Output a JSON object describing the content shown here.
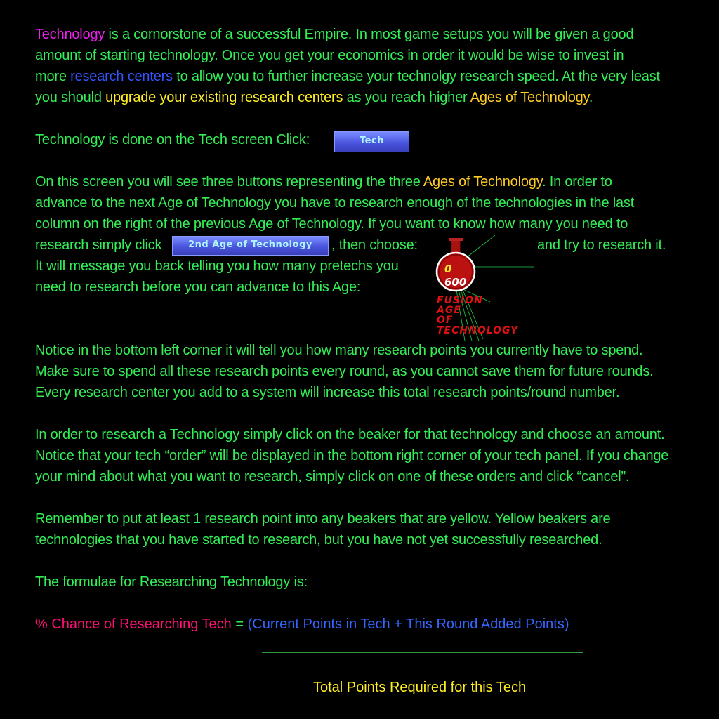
{
  "para1": {
    "tech_word": "Technology",
    "s1": " is a cornorstone of a successful Empire.  In most game setups you will be given a good",
    "l2": "amount of starting technology.  Once you get your economics in order it would be wise to invest in",
    "l3_pre": "more ",
    "research_centers": "research centers",
    "l3_post": " to allow you to further increase your technolgy research speed.  At the very least",
    "l4_pre": "you should ",
    "upgrade": "upgrade your existing research centers",
    "l4_mid": " as you reach higher ",
    "ages": "Ages of Technology",
    "l4_post": "."
  },
  "para2": {
    "text": "Technology is done on the Tech screen Click:",
    "tech_button": "Tech"
  },
  "para3": {
    "l1_pre": "On this screen you will see three buttons representing the three ",
    "ages": "Ages of Technology",
    "l1_post": ".  In order to",
    "l2": "advance to the next Age of Technology you have to research enough of the technologies in the last",
    "l3": "column on the right of the previous Age of Technology.  If you want to know how many you need to",
    "l4_pre": "research simply click",
    "age_button": "2nd Age of Technology",
    "l4_mid": ", then choose:",
    "l4_post": "and try to research it.",
    "l5": "It will message you back telling you how many pretechs you",
    "l6": " need to research before you can advance to this Age:"
  },
  "beaker": {
    "current": "0",
    "required": "600",
    "label_lines": [
      "FUSION",
      "AGE",
      "OF",
      "TECHNOLOGY"
    ]
  },
  "para4": {
    "l1": "Notice in the bottom left corner it will tell you how many research points you currently have to spend.",
    "l2": "Make sure to spend all these research points every round, as you cannot save them for future rounds.",
    "l3": "Every research center you add to a system will increase this total research points/round number."
  },
  "para5": {
    "l1": "In order to research a Technology simply click on the beaker for that technology and choose an amount.",
    "l2": "Notice that your tech “order” will be displayed in the bottom right corner of your tech panel.  If you change",
    "l3": "your mind about what you want to research, simply click on one of these orders and click “cancel”."
  },
  "para6": {
    "l1": "Remember to put at least 1 research point into any beakers that are yellow.  Yellow beakers are",
    "l2": "technologies that you have started to research, but you have not yet successfully researched."
  },
  "para7": {
    "l1": "The formulae for Researching Technology is:"
  },
  "formula": {
    "lhs": "% Chance of Researching Tech",
    "equals": " = ",
    "open": "(",
    "term1": "Current Points in Tech",
    "plus": " + ",
    "term2": "This Round Added Points",
    "close": ")",
    "denominator": "Total Points Required for this Tech"
  },
  "colors": {
    "body_text": "#33ee55",
    "technology_word": "#ee22ee",
    "link_blue": "#3355ff",
    "highlight_yellow": "#ffee22",
    "ages_gold": "#ffcc22",
    "formula_pink": "#ff1177",
    "beaker_red": "#cc1111"
  }
}
